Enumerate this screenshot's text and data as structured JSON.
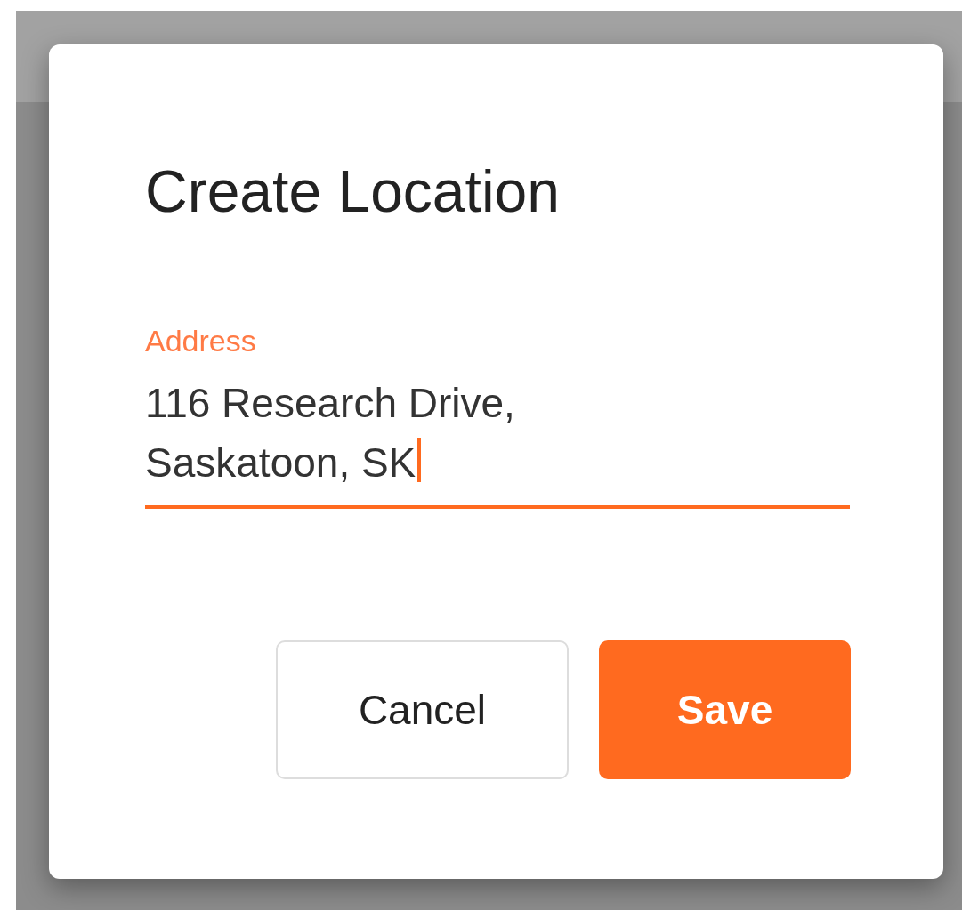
{
  "dialog": {
    "title": "Create Location",
    "field": {
      "label": "Address",
      "value": "116 Research Drive, Saskatoon, SK",
      "focused": true
    },
    "buttons": [
      {
        "label": "Cancel",
        "kind": "secondary"
      },
      {
        "label": "Save",
        "kind": "primary"
      }
    ]
  }
}
